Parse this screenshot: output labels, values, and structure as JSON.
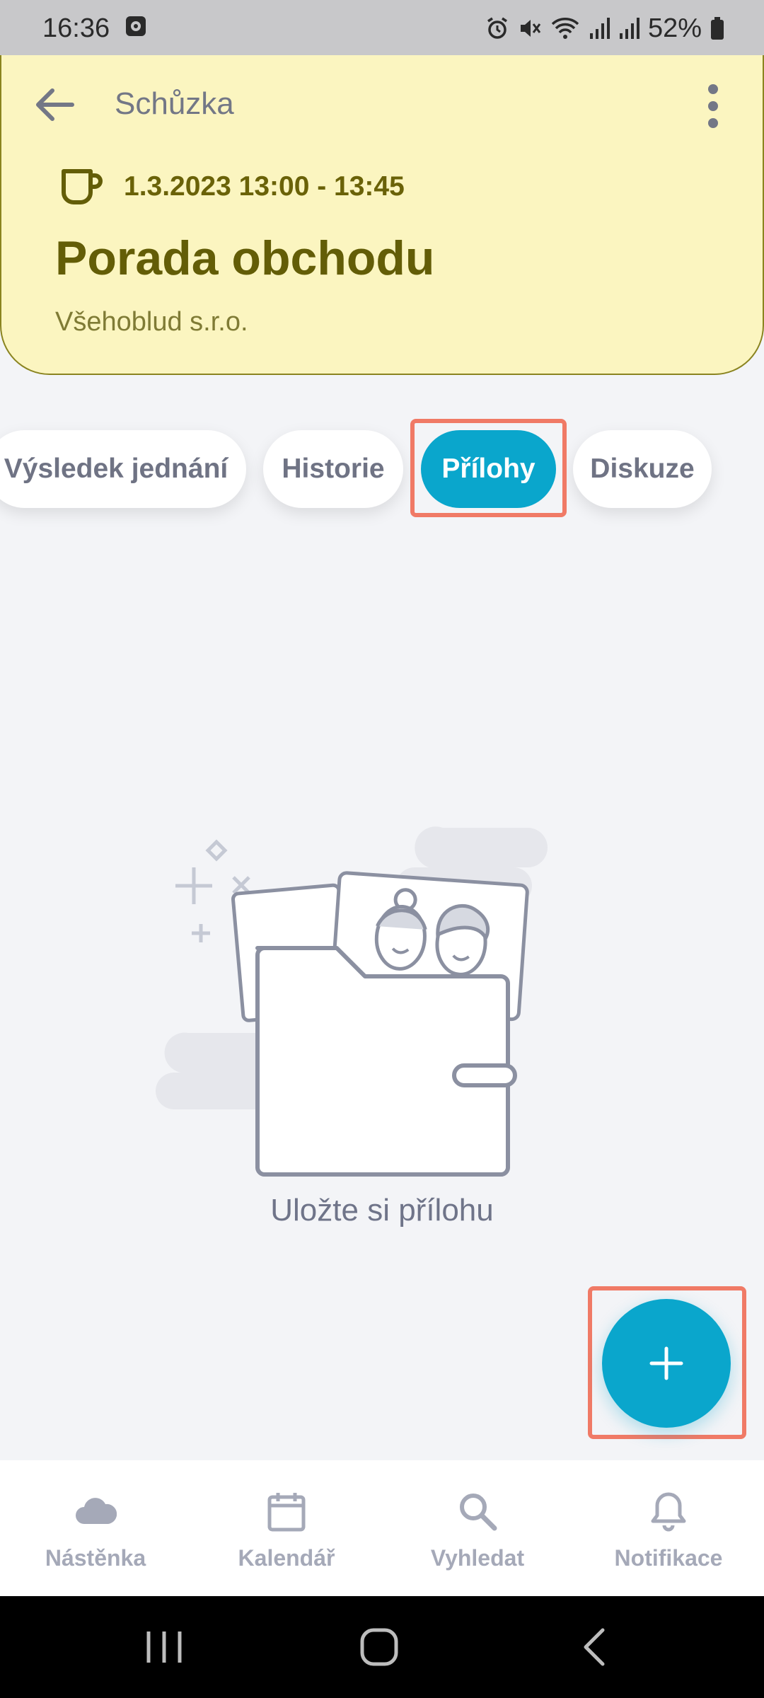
{
  "status_bar": {
    "time": "16:36",
    "battery_percent": "52%",
    "icons": [
      "notification-icon",
      "alarm-icon",
      "mute-icon",
      "wifi-icon",
      "signal-icon",
      "signal-icon",
      "battery-icon"
    ]
  },
  "header": {
    "title": "Schůzka",
    "meeting_time": "1.3.2023 13:00 - 13:45",
    "meeting_title": "Porada obchodu",
    "company": "Všehoblud s.r.o.",
    "background_color": "#fbf5c0"
  },
  "tabs": [
    {
      "label": "Výsledek jednání",
      "active": false
    },
    {
      "label": "Historie",
      "active": false
    },
    {
      "label": "Přílohy",
      "active": true
    },
    {
      "label": "Diskuze",
      "active": false
    }
  ],
  "empty_state": {
    "text": "Uložte si přílohu"
  },
  "fab": {
    "icon": "plus-icon",
    "color": "#0aa6cc"
  },
  "bottom_nav": [
    {
      "label": "Nástěnka",
      "icon": "cloud-icon"
    },
    {
      "label": "Kalendář",
      "icon": "calendar-icon"
    },
    {
      "label": "Vyhledat",
      "icon": "search-icon"
    },
    {
      "label": "Notifikace",
      "icon": "bell-icon"
    }
  ],
  "accent_color": "#0aa6cc",
  "highlight_color": "#f07a66"
}
